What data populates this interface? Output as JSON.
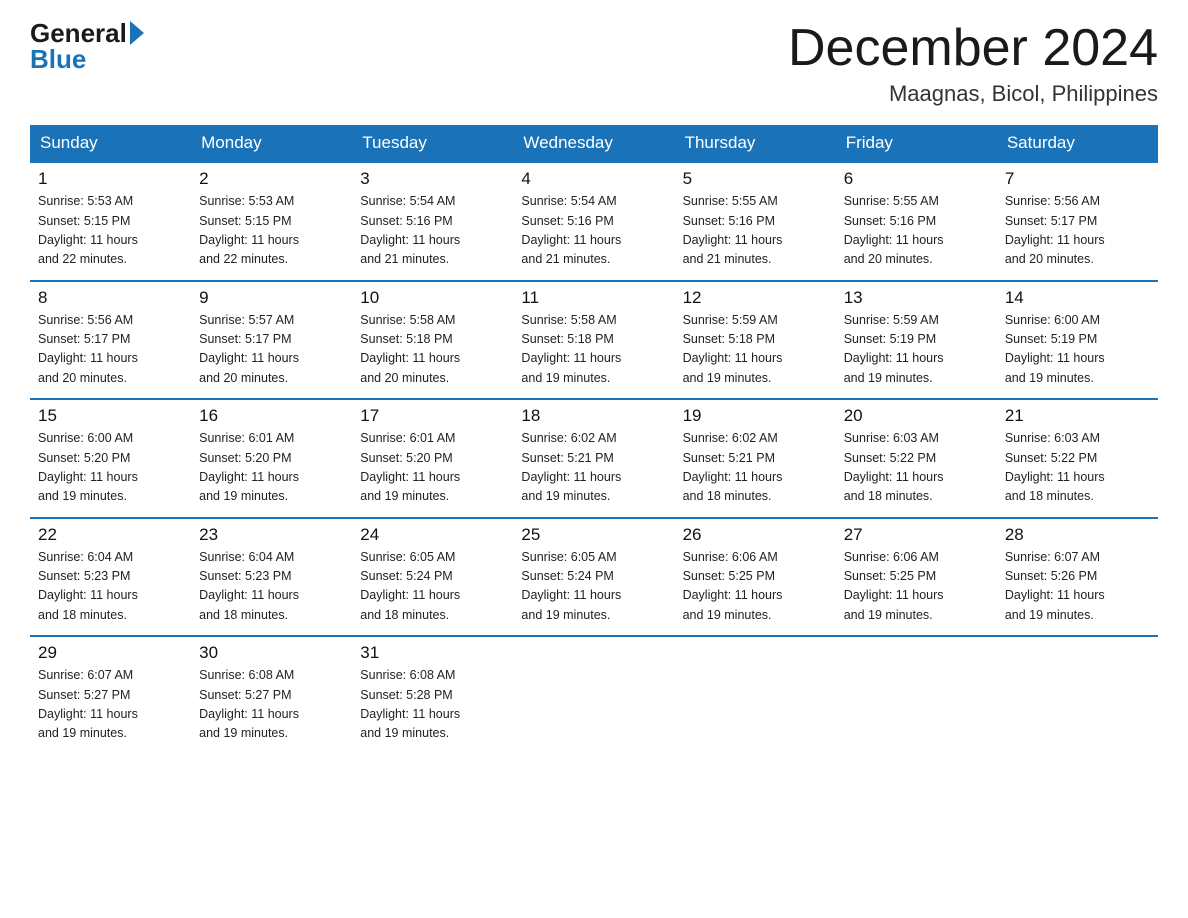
{
  "logo": {
    "general": "General",
    "blue": "Blue"
  },
  "header": {
    "month": "December 2024",
    "location": "Maagnas, Bicol, Philippines"
  },
  "weekdays": [
    "Sunday",
    "Monday",
    "Tuesday",
    "Wednesday",
    "Thursday",
    "Friday",
    "Saturday"
  ],
  "weeks": [
    [
      {
        "day": "1",
        "sunrise": "5:53 AM",
        "sunset": "5:15 PM",
        "daylight": "11 hours and 22 minutes."
      },
      {
        "day": "2",
        "sunrise": "5:53 AM",
        "sunset": "5:15 PM",
        "daylight": "11 hours and 22 minutes."
      },
      {
        "day": "3",
        "sunrise": "5:54 AM",
        "sunset": "5:16 PM",
        "daylight": "11 hours and 21 minutes."
      },
      {
        "day": "4",
        "sunrise": "5:54 AM",
        "sunset": "5:16 PM",
        "daylight": "11 hours and 21 minutes."
      },
      {
        "day": "5",
        "sunrise": "5:55 AM",
        "sunset": "5:16 PM",
        "daylight": "11 hours and 21 minutes."
      },
      {
        "day": "6",
        "sunrise": "5:55 AM",
        "sunset": "5:16 PM",
        "daylight": "11 hours and 20 minutes."
      },
      {
        "day": "7",
        "sunrise": "5:56 AM",
        "sunset": "5:17 PM",
        "daylight": "11 hours and 20 minutes."
      }
    ],
    [
      {
        "day": "8",
        "sunrise": "5:56 AM",
        "sunset": "5:17 PM",
        "daylight": "11 hours and 20 minutes."
      },
      {
        "day": "9",
        "sunrise": "5:57 AM",
        "sunset": "5:17 PM",
        "daylight": "11 hours and 20 minutes."
      },
      {
        "day": "10",
        "sunrise": "5:58 AM",
        "sunset": "5:18 PM",
        "daylight": "11 hours and 20 minutes."
      },
      {
        "day": "11",
        "sunrise": "5:58 AM",
        "sunset": "5:18 PM",
        "daylight": "11 hours and 19 minutes."
      },
      {
        "day": "12",
        "sunrise": "5:59 AM",
        "sunset": "5:18 PM",
        "daylight": "11 hours and 19 minutes."
      },
      {
        "day": "13",
        "sunrise": "5:59 AM",
        "sunset": "5:19 PM",
        "daylight": "11 hours and 19 minutes."
      },
      {
        "day": "14",
        "sunrise": "6:00 AM",
        "sunset": "5:19 PM",
        "daylight": "11 hours and 19 minutes."
      }
    ],
    [
      {
        "day": "15",
        "sunrise": "6:00 AM",
        "sunset": "5:20 PM",
        "daylight": "11 hours and 19 minutes."
      },
      {
        "day": "16",
        "sunrise": "6:01 AM",
        "sunset": "5:20 PM",
        "daylight": "11 hours and 19 minutes."
      },
      {
        "day": "17",
        "sunrise": "6:01 AM",
        "sunset": "5:20 PM",
        "daylight": "11 hours and 19 minutes."
      },
      {
        "day": "18",
        "sunrise": "6:02 AM",
        "sunset": "5:21 PM",
        "daylight": "11 hours and 19 minutes."
      },
      {
        "day": "19",
        "sunrise": "6:02 AM",
        "sunset": "5:21 PM",
        "daylight": "11 hours and 18 minutes."
      },
      {
        "day": "20",
        "sunrise": "6:03 AM",
        "sunset": "5:22 PM",
        "daylight": "11 hours and 18 minutes."
      },
      {
        "day": "21",
        "sunrise": "6:03 AM",
        "sunset": "5:22 PM",
        "daylight": "11 hours and 18 minutes."
      }
    ],
    [
      {
        "day": "22",
        "sunrise": "6:04 AM",
        "sunset": "5:23 PM",
        "daylight": "11 hours and 18 minutes."
      },
      {
        "day": "23",
        "sunrise": "6:04 AM",
        "sunset": "5:23 PM",
        "daylight": "11 hours and 18 minutes."
      },
      {
        "day": "24",
        "sunrise": "6:05 AM",
        "sunset": "5:24 PM",
        "daylight": "11 hours and 18 minutes."
      },
      {
        "day": "25",
        "sunrise": "6:05 AM",
        "sunset": "5:24 PM",
        "daylight": "11 hours and 19 minutes."
      },
      {
        "day": "26",
        "sunrise": "6:06 AM",
        "sunset": "5:25 PM",
        "daylight": "11 hours and 19 minutes."
      },
      {
        "day": "27",
        "sunrise": "6:06 AM",
        "sunset": "5:25 PM",
        "daylight": "11 hours and 19 minutes."
      },
      {
        "day": "28",
        "sunrise": "6:07 AM",
        "sunset": "5:26 PM",
        "daylight": "11 hours and 19 minutes."
      }
    ],
    [
      {
        "day": "29",
        "sunrise": "6:07 AM",
        "sunset": "5:27 PM",
        "daylight": "11 hours and 19 minutes."
      },
      {
        "day": "30",
        "sunrise": "6:08 AM",
        "sunset": "5:27 PM",
        "daylight": "11 hours and 19 minutes."
      },
      {
        "day": "31",
        "sunrise": "6:08 AM",
        "sunset": "5:28 PM",
        "daylight": "11 hours and 19 minutes."
      },
      null,
      null,
      null,
      null
    ]
  ],
  "labels": {
    "sunrise": "Sunrise:",
    "sunset": "Sunset:",
    "daylight": "Daylight:"
  }
}
